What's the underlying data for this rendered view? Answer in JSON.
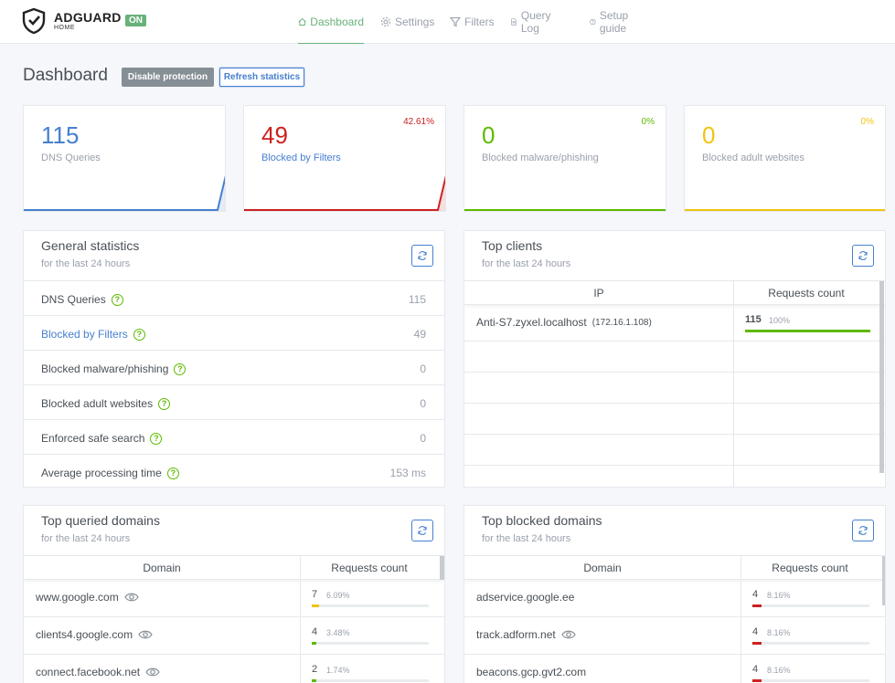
{
  "header": {
    "logo_text": "ADGUARD",
    "logo_sub": "HOME",
    "status_badge": "ON",
    "nav": [
      {
        "label": "Dashboard",
        "icon": "home-icon"
      },
      {
        "label": "Settings",
        "icon": "gear-icon"
      },
      {
        "label": "Filters",
        "icon": "filter-icon"
      },
      {
        "label": "Query Log",
        "icon": "document-icon"
      },
      {
        "label": "Setup guide",
        "icon": "help-circle-icon"
      }
    ]
  },
  "page": {
    "title": "Dashboard",
    "disable_button": "Disable protection",
    "refresh_button": "Refresh statistics"
  },
  "stats": [
    {
      "value": "115",
      "label": "DNS Queries",
      "percent": "",
      "color": "#467fcf"
    },
    {
      "value": "49",
      "label": "Blocked by Filters",
      "percent": "42.61%",
      "color": "#cd201f"
    },
    {
      "value": "0",
      "label": "Blocked malware/phishing",
      "percent": "0%",
      "color": "#5eba00"
    },
    {
      "value": "0",
      "label": "Blocked adult websites",
      "percent": "0%",
      "color": "#f1c40f"
    }
  ],
  "general": {
    "title": "General statistics",
    "subtitle": "for the last 24 hours",
    "rows": [
      {
        "label": "DNS Queries",
        "value": "115"
      },
      {
        "label": "Blocked by Filters",
        "value": "49"
      },
      {
        "label": "Blocked malware/phishing",
        "value": "0"
      },
      {
        "label": "Blocked adult websites",
        "value": "0"
      },
      {
        "label": "Enforced safe search",
        "value": "0"
      },
      {
        "label": "Average processing time",
        "value": "153 ms"
      }
    ]
  },
  "clients": {
    "title": "Top clients",
    "subtitle": "for the last 24 hours",
    "col_ip": "IP",
    "col_count": "Requests count",
    "rows": [
      {
        "name": "Anti-S7.zyxel.localhost",
        "ip": "(172.16.1.108)",
        "count": "115",
        "percent": "100%",
        "fraction": 1.0
      }
    ]
  },
  "queried": {
    "title": "Top queried domains",
    "subtitle": "for the last 24 hours",
    "col_domain": "Domain",
    "col_count": "Requests count",
    "bar_color": "#f1c40f",
    "rows": [
      {
        "domain": "www.google.com",
        "count": "7",
        "percent": "6.09%",
        "fraction": 0.0609,
        "color": "#f1c40f"
      },
      {
        "domain": "clients4.google.com",
        "count": "4",
        "percent": "3.48%",
        "fraction": 0.0348,
        "color": "#5eba00"
      },
      {
        "domain": "connect.facebook.net",
        "count": "2",
        "percent": "1.74%",
        "fraction": 0.0174,
        "color": "#5eba00"
      }
    ]
  },
  "blocked": {
    "title": "Top blocked domains",
    "subtitle": "for the last 24 hours",
    "col_domain": "Domain",
    "col_count": "Requests count",
    "rows": [
      {
        "domain": "adservice.google.ee",
        "count": "4",
        "percent": "8.16%",
        "fraction": 0.0816,
        "eye": false
      },
      {
        "domain": "track.adform.net",
        "count": "4",
        "percent": "8.16%",
        "fraction": 0.0816,
        "eye": true
      },
      {
        "domain": "beacons.gcp.gvt2.com",
        "count": "4",
        "percent": "8.16%",
        "fraction": 0.0816,
        "eye": false
      }
    ]
  }
}
